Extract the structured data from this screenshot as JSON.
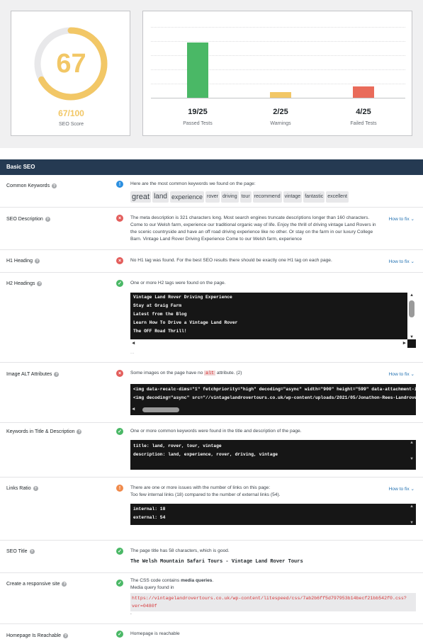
{
  "score": {
    "value": "67",
    "fraction": "67/100",
    "label": "SEO Score",
    "percent": 67
  },
  "tests": [
    {
      "count": "19/25",
      "label": "Passed Tests",
      "value": 19,
      "color": "#4ab866"
    },
    {
      "count": "2/25",
      "label": "Warnings",
      "value": 2,
      "color": "#f2c766"
    },
    {
      "count": "4/25",
      "label": "Failed Tests",
      "value": 4,
      "color": "#e96b5a"
    }
  ],
  "section_title": "Basic SEO",
  "howto": "How to fix",
  "rows": {
    "keywords": {
      "label": "Common Keywords",
      "message": "Here are the most common keywords we found on the page:",
      "words": [
        "great",
        "land",
        "experience",
        "rover",
        "driving",
        "tour",
        "recommend",
        "vintage",
        "fantastic",
        "excellent"
      ]
    },
    "description": {
      "label": "SEO Description",
      "message": "The meta description is 321 characters long. Most search engines truncate descriptions longer than 160 characters. Come to our Welsh farm, experience our traditional organic way of life. Enjoy the thrill of driving vintage Land Rovers in the scenic countryside and have an off road driving experience like no other. Or stay on the farm in our luxury College Barn. Vintage Land Rover Driving Experience Come to our Welsh farm, experience"
    },
    "h1": {
      "label": "H1 Heading",
      "message": "No H1 tag was found. For the best SEO results there should be exactly one H1 tag on each page."
    },
    "h2": {
      "label": "H2 Headings",
      "message": "One or more H2 tags were found on the page.",
      "lines": [
        "Vintage Land Rover Driving Experience",
        "Stay at Graig Farm",
        "Latest from the Blog",
        "Learn How To Drive a Vintage Land Rover",
        "The OFF Road Thrill!"
      ],
      "more": "..."
    },
    "alt": {
      "label": "Image ALT Attributes",
      "message_pre": "Some images on the page have no",
      "message_code": "alt",
      "message_post": "attribute. (2)",
      "lines": [
        "<img data-recalc-dims=\"1\" fetchpriority=\"high\" decoding=\"async\" width=\"900\" height=\"599\" data-attachment-id",
        "<img decoding=\"async\" src=\"//vintagelandrovertours.co.uk/wp-content/uploads/2021/05/Jonathon-Rees-Landrover"
      ]
    },
    "kw_title": {
      "label": "Keywords in Title & Description",
      "message": "One or more common keywords were found in the title and description of the page.",
      "lines": [
        "title: land, rover, tour, vintage",
        "description: land, experience, rover, driving, vintage"
      ]
    },
    "links": {
      "label": "Links Ratio",
      "message1": "There are one or more issues with the number of links on this page:",
      "message2": "Too few internal links (18) compared to the number of external links (54).",
      "lines": [
        "internal: 18",
        "external: 54"
      ]
    },
    "seo_title": {
      "label": "SEO Title",
      "message": "The page title has 58 characters, which is good.",
      "title": "The Welsh Mountain Safari Tours - Vintage Land Rover Tours"
    },
    "responsive": {
      "label": "Create a responsive site",
      "message_pre": "The CSS code contains",
      "message_bold": "media queries",
      "message_post": ".",
      "message2": "Media query found in",
      "url": "https://vintagelandrovertours.co.uk/wp-content/litespeed/css/7ab2b6ff5d797953b14becf21bb542f0.css?ver=0480f",
      "trail": "."
    },
    "reachable": {
      "label": "Homepage Is Reachable",
      "message": "Homepage is reachable"
    }
  }
}
